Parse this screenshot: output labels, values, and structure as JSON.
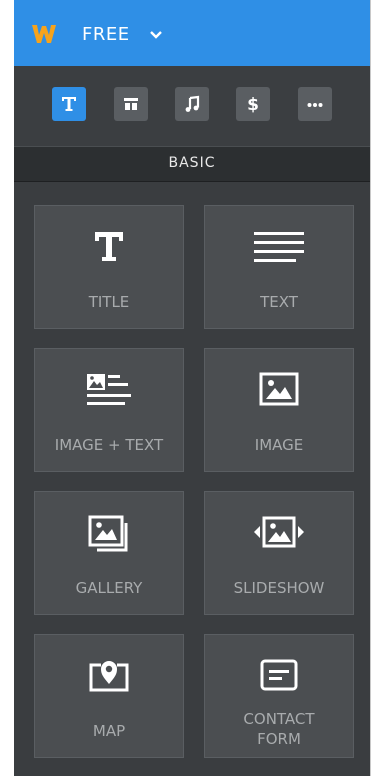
{
  "header": {
    "plan_label": "FREE"
  },
  "toolbar": {
    "buttons": [
      {
        "name": "basic",
        "active": true
      },
      {
        "name": "structure",
        "active": false
      },
      {
        "name": "media",
        "active": false
      },
      {
        "name": "commerce",
        "active": false
      },
      {
        "name": "more",
        "active": false
      }
    ]
  },
  "section": {
    "label": "BASIC"
  },
  "tiles": [
    {
      "label": "TITLE",
      "icon": "title-icon"
    },
    {
      "label": "TEXT",
      "icon": "text-icon"
    },
    {
      "label": "IMAGE + TEXT",
      "icon": "image-text-icon"
    },
    {
      "label": "IMAGE",
      "icon": "image-icon"
    },
    {
      "label": "GALLERY",
      "icon": "gallery-icon"
    },
    {
      "label": "SLIDESHOW",
      "icon": "slideshow-icon"
    },
    {
      "label": "MAP",
      "icon": "map-icon"
    },
    {
      "label": "CONTACT",
      "label2": "FORM",
      "icon": "contact-form-icon"
    }
  ],
  "colors": {
    "accent": "#2f8fe6",
    "logo": "#f6a31c",
    "panel": "#3a3d40",
    "tile": "#4b4e51"
  }
}
